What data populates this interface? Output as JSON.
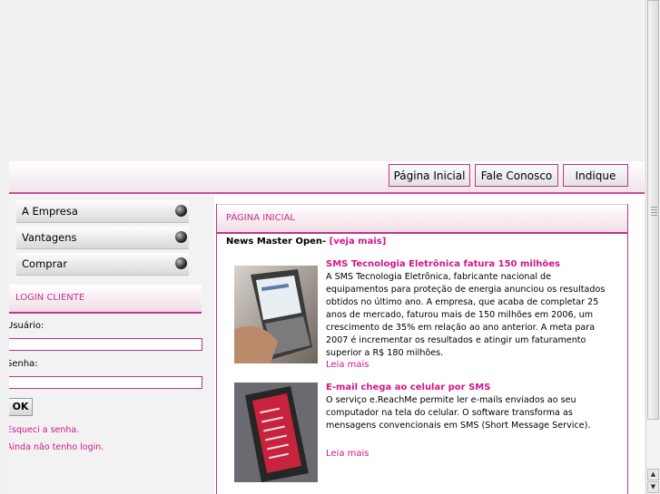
{
  "nav": {
    "home": "Página Inicial",
    "contact": "Fale Conosco",
    "refer": "Indique"
  },
  "menu": {
    "items": [
      {
        "label": "A Empresa"
      },
      {
        "label": "Vantagens"
      },
      {
        "label": "Comprar"
      }
    ]
  },
  "login": {
    "title": "LOGIN CLIENTE",
    "user_label": "Usuário:",
    "pass_label": "Senha:",
    "ok_label": "OK",
    "forgot": "Esqueci a senha.",
    "no_login": "Ainda não tenho login."
  },
  "content": {
    "header": "PÁGINA INICIAL",
    "news_master": "News Master Open-",
    "news_master_more": "[veja mais]",
    "articles": [
      {
        "title": "SMS Tecnologia Eletrônica fatura 150 milhões",
        "body": "A SMS Tecnologia Eletrônica, fabricante nacional de equipamentos para proteção de energia anunciou os resultados obtidos no último ano. A empresa, que acaba de completar 25 anos de mercado, faturou mais de 150 milhões em 2006, um crescimento de 35% em relação ao ano anterior. A meta para 2007 é incrementar os resultados e atingir um faturamento superior a R$ 180 milhões.",
        "read_more": "Leia mais"
      },
      {
        "title": "E-mail chega ao celular por SMS",
        "body": "O serviço e.ReachMe permite ler e-mails enviados ao seu computador na tela do celular. O software transforma as mensagens convencionais em SMS (Short Message Service).",
        "read_more": "Leia mais"
      }
    ]
  },
  "colors": {
    "accent": "#c0348a",
    "link": "#d0178a"
  }
}
